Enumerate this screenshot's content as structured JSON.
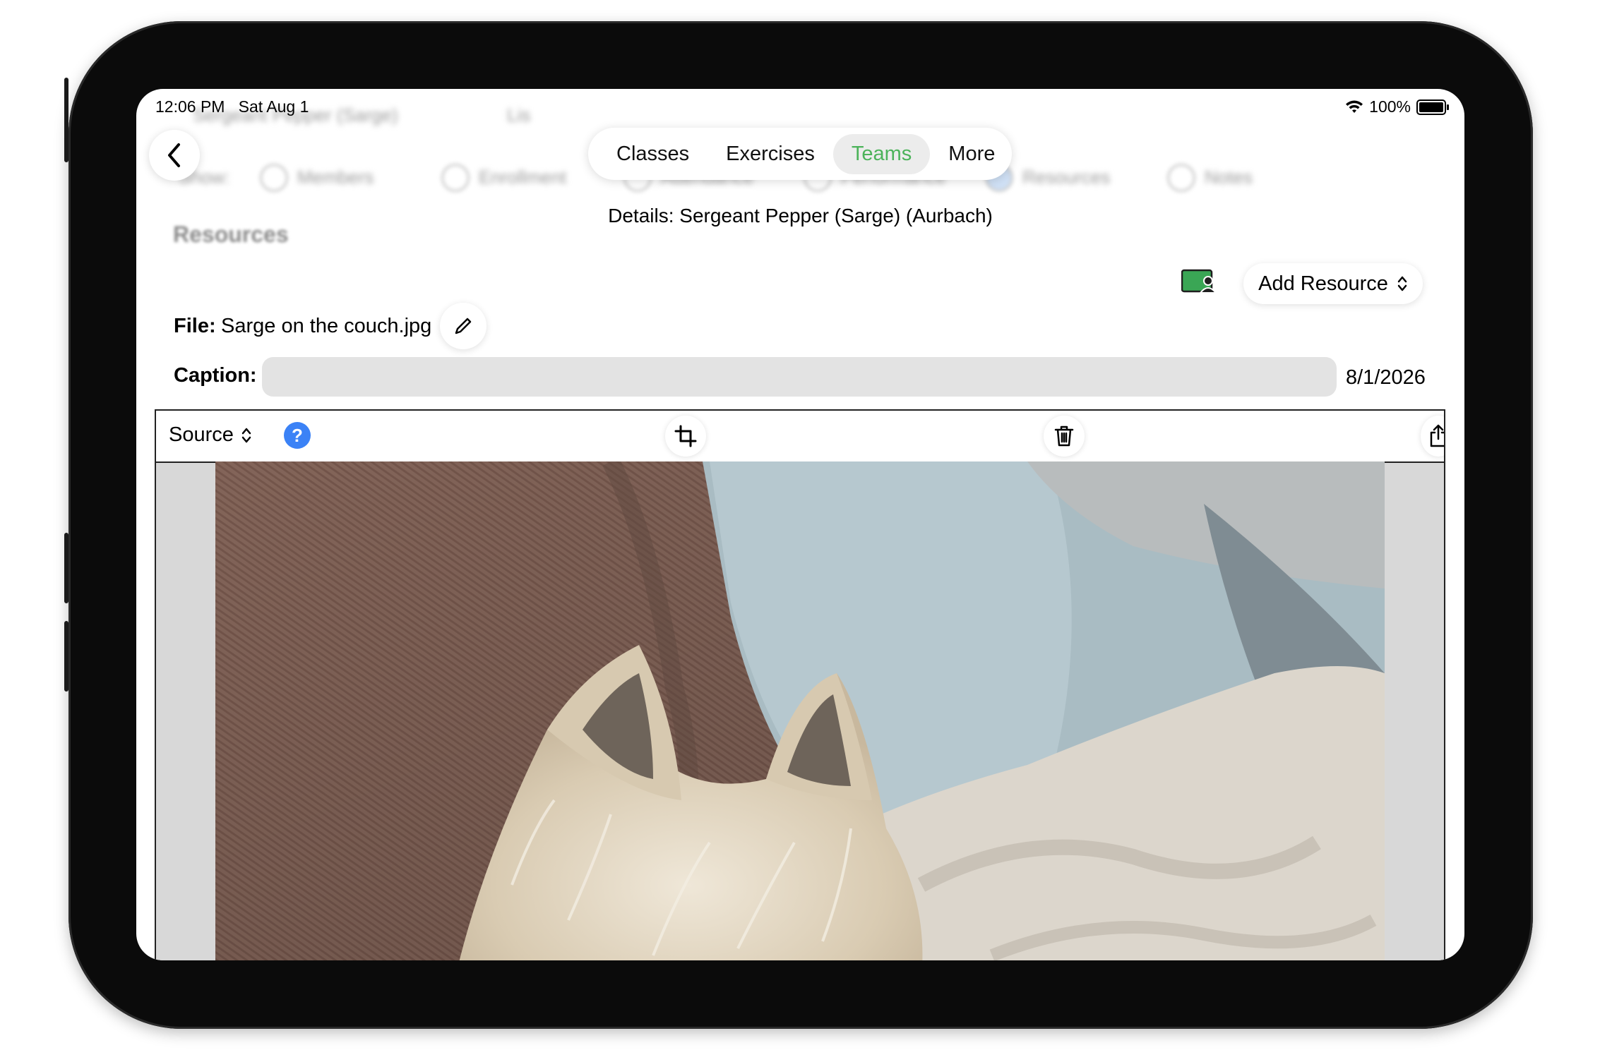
{
  "status_bar": {
    "time": "12:06 PM",
    "date": "Sat Aug 1",
    "battery": "100%"
  },
  "background_ghost": {
    "name": "Sergeant Pepper (Sarge)",
    "list": "Lis",
    "show": "Show:",
    "options": [
      "Members",
      "Enrollment",
      "Attendance",
      "Performance",
      "Resources",
      "Notes"
    ],
    "section": "Resources"
  },
  "tabs": [
    {
      "label": "Classes",
      "active": false
    },
    {
      "label": "Exercises",
      "active": false
    },
    {
      "label": "Teams",
      "active": true
    },
    {
      "label": "More",
      "active": false
    }
  ],
  "details_title": "Details: Sergeant Pepper (Sarge) (Aurbach)",
  "add_resource_label": "Add Resource",
  "file": {
    "label": "File:",
    "name": "Sarge on the couch.jpg"
  },
  "caption": {
    "label": "Caption:",
    "value": "",
    "date": "8/1/2026"
  },
  "panel": {
    "source_label": "Source",
    "help_label": "?"
  },
  "icons": [
    "back-chevron-icon",
    "wifi-icon",
    "battery-icon",
    "person-card-icon",
    "chevron-updown-icon",
    "pencil-icon",
    "help-icon",
    "crop-icon",
    "trash-icon",
    "share-icon"
  ],
  "colors": {
    "active_tab": "#4cb35a",
    "help_blue": "#3b82f6",
    "resource_icon_green": "#3aa655"
  }
}
